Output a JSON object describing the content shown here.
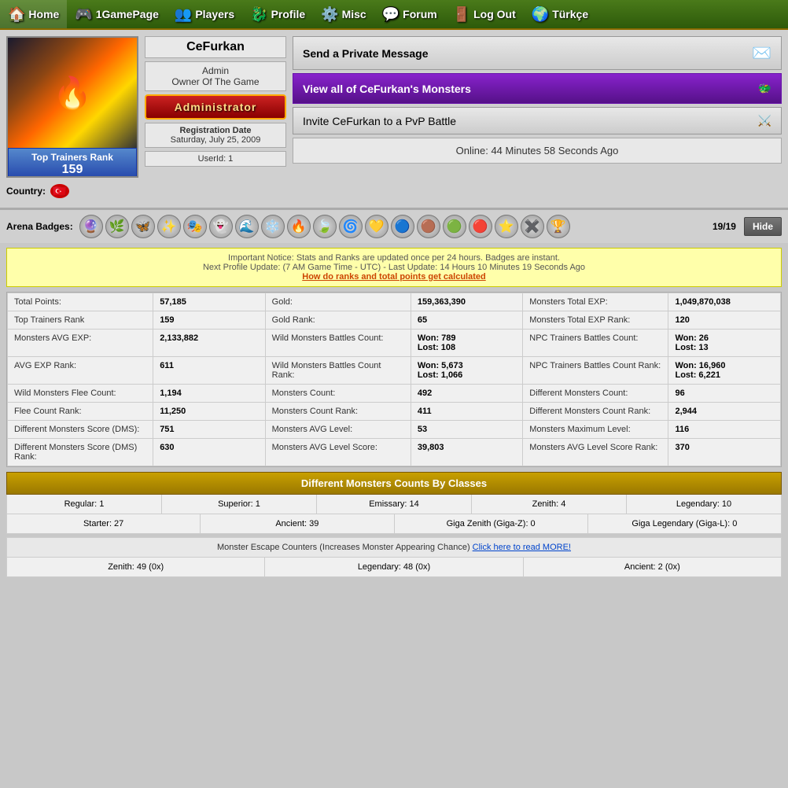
{
  "nav": {
    "items": [
      {
        "label": "Home",
        "icon": "🏠"
      },
      {
        "label": "1GamePage",
        "icon": "🎮"
      },
      {
        "label": "Players",
        "icon": "👥"
      },
      {
        "label": "Profile",
        "icon": "🐉"
      },
      {
        "label": "Misc",
        "icon": "⚙️"
      },
      {
        "label": "Forum",
        "icon": "💬"
      },
      {
        "label": "Log Out",
        "icon": "🚪"
      },
      {
        "label": "Türkçe",
        "icon": "🌍"
      }
    ]
  },
  "profile": {
    "username": "CeFurkan",
    "role1": "Admin",
    "role2": "Owner Of The Game",
    "admin_badge_label": "Administrator",
    "reg_label": "Registration Date",
    "reg_date": "Saturday, July 25, 2009",
    "userid_label": "UserId: 1",
    "rank_label": "Top Trainers Rank",
    "rank_value": "159",
    "country_label": "Country:",
    "send_pm_label": "Send a Private Message",
    "view_monsters_label": "View all of CeFurkan's Monsters",
    "pvp_label": "Invite CeFurkan to a PvP Battle",
    "online_label": "Online: 44 Minutes 58 Seconds Ago"
  },
  "arena": {
    "label": "Arena Badges:",
    "count": "19/19",
    "hide_label": "Hide",
    "badges": [
      "🔮",
      "🌿",
      "🦋",
      "✨",
      "🎭",
      "👻",
      "🌊",
      "❄️",
      "🔥",
      "🍃",
      "🌀",
      "💛",
      "🔵",
      "🟤",
      "🟢",
      "🔴",
      "⭐",
      "✖️",
      "🏆"
    ]
  },
  "notice": {
    "line1": "Important Notice: Stats and Ranks are updated once per 24 hours. Badges are instant.",
    "line2": "Next Profile Update: (7 AM Game Time - UTC) - Last Update: 14 Hours 10 Minutes 19 Seconds Ago",
    "rank_link": "How do ranks and total points get calculated"
  },
  "stats": [
    {
      "label": "Total Points:",
      "value": "57,185",
      "label2": "Gold:",
      "value2": "159,363,390",
      "label3": "Monsters Total EXP:",
      "value3": "1,049,870,038"
    },
    {
      "label": "Top Trainers Rank",
      "value": "159",
      "label2": "Gold Rank:",
      "value2": "65",
      "label3": "Monsters Total EXP Rank:",
      "value3": "120"
    },
    {
      "label": "Monsters AVG EXP:",
      "value": "2,133,882",
      "label2": "Wild Monsters Battles Count:",
      "value2": "Won: 789\nLost: 108",
      "label3": "NPC Trainers Battles Count:",
      "value3": "Won: 26\nLost: 13"
    },
    {
      "label": "AVG EXP Rank:",
      "value": "611",
      "label2": "Wild Monsters Battles Count Rank:",
      "value2": "Won: 5,673\nLost: 1,066",
      "label3": "NPC Trainers Battles Count Rank:",
      "value3": "Won: 16,960\nLost: 6,221"
    },
    {
      "label": "Wild Monsters Flee Count:",
      "value": "1,194",
      "label2": "Monsters Count:",
      "value2": "492",
      "label3": "Different Monsters Count:",
      "value3": "96"
    },
    {
      "label": "Flee Count Rank:",
      "value": "11,250",
      "label2": "Monsters Count Rank:",
      "value2": "411",
      "label3": "Different Monsters Count Rank:",
      "value3": "2,944"
    },
    {
      "label": "Different Monsters Score (DMS):",
      "value": "751",
      "label2": "Monsters AVG Level:",
      "value2": "53",
      "label3": "Monsters Maximum Level:",
      "value3": "116"
    },
    {
      "label": "Different Monsters Score (DMS) Rank:",
      "value": "630",
      "label2": "Monsters AVG Level Score:",
      "value2": "39,803",
      "label3": "Monsters AVG Level Score Rank:",
      "value3": "370"
    }
  ],
  "classes_header": "Different Monsters Counts By Classes",
  "classes": [
    {
      "label": "Regular: 1"
    },
    {
      "label": "Superior: 1"
    },
    {
      "label": "Emissary: 14"
    },
    {
      "label": "Zenith: 4"
    },
    {
      "label": "Legendary: 10"
    }
  ],
  "classes2": [
    {
      "label": "Starter: 27"
    },
    {
      "label": "Ancient: 39"
    },
    {
      "label": "Giga Zenith (Giga-Z): 0"
    },
    {
      "label": "Giga Legendary (Giga-L): 0"
    }
  ],
  "escape_header": "Monster Escape Counters (Increases Monster Appearing Chance)",
  "escape_link": "Click here to read MORE!",
  "escape": [
    {
      "label": "Zenith: 49 (0x)"
    },
    {
      "label": "Legendary: 48 (0x)"
    },
    {
      "label": "Ancient: 2 (0x)"
    }
  ]
}
